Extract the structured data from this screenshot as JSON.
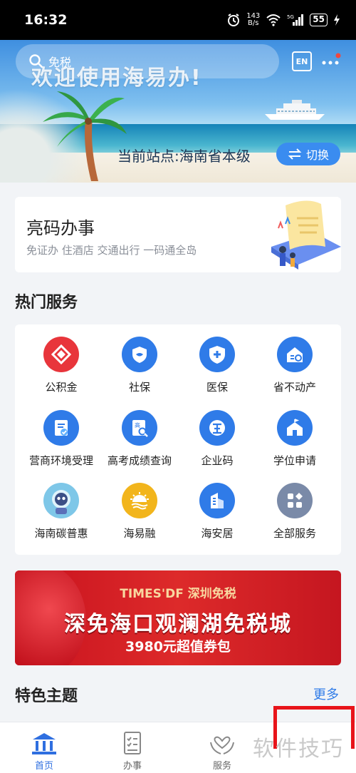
{
  "status_bar": {
    "time": "16:32",
    "net_speed_value": "143",
    "net_speed_unit": "B/s",
    "signal_label": "5G",
    "battery": "55"
  },
  "header": {
    "search_placeholder": "免税",
    "welcome_text": "欢迎使用海易办!",
    "language_button": "EN",
    "station_text": "当前站点:海南省本级",
    "switch_button": "切换"
  },
  "code_card": {
    "title": "亮码办事",
    "subtitle": "免证办 住酒店 交通出行 一码通全岛"
  },
  "hot_services": {
    "title": "热门服务",
    "items": [
      {
        "label": "公积金",
        "icon": "housing-fund-icon",
        "color": "#e8353b"
      },
      {
        "label": "社保",
        "icon": "social-security-icon",
        "color": "#2f7be8"
      },
      {
        "label": "医保",
        "icon": "medical-insurance-icon",
        "color": "#2f7be8"
      },
      {
        "label": "省不动产",
        "icon": "real-estate-icon",
        "color": "#2f7be8"
      },
      {
        "label": "营商环境受理",
        "icon": "business-environment-icon",
        "color": "#2f7be8"
      },
      {
        "label": "高考成绩查询",
        "icon": "exam-score-icon",
        "color": "#2f7be8"
      },
      {
        "label": "企业码",
        "icon": "enterprise-code-icon",
        "color": "#2f7be8"
      },
      {
        "label": "学位申请",
        "icon": "school-degree-icon",
        "color": "#2f7be8"
      },
      {
        "label": "海南碳普惠",
        "icon": "carbon-mascot-icon",
        "color": "#7ec7e8"
      },
      {
        "label": "海易融",
        "icon": "sun-finance-icon",
        "color": "#f2b51c"
      },
      {
        "label": "海安居",
        "icon": "building-icon",
        "color": "#2f7be8"
      },
      {
        "label": "全部服务",
        "icon": "all-services-icon",
        "color": "#7a8aa8"
      }
    ]
  },
  "ad": {
    "brand": "TIMES'DF 深圳免税",
    "title": "深免海口观澜湖免税城",
    "subtitle": "3980元超值券包"
  },
  "featured": {
    "title": "特色主题",
    "more": "更多"
  },
  "bottom_nav": {
    "items": [
      {
        "label": "首页",
        "icon": "home-icon",
        "active": true
      },
      {
        "label": "办事",
        "icon": "checklist-icon",
        "active": false
      },
      {
        "label": "服务",
        "icon": "heart-hands-icon",
        "active": false
      }
    ]
  },
  "watermark": "软件技巧"
}
